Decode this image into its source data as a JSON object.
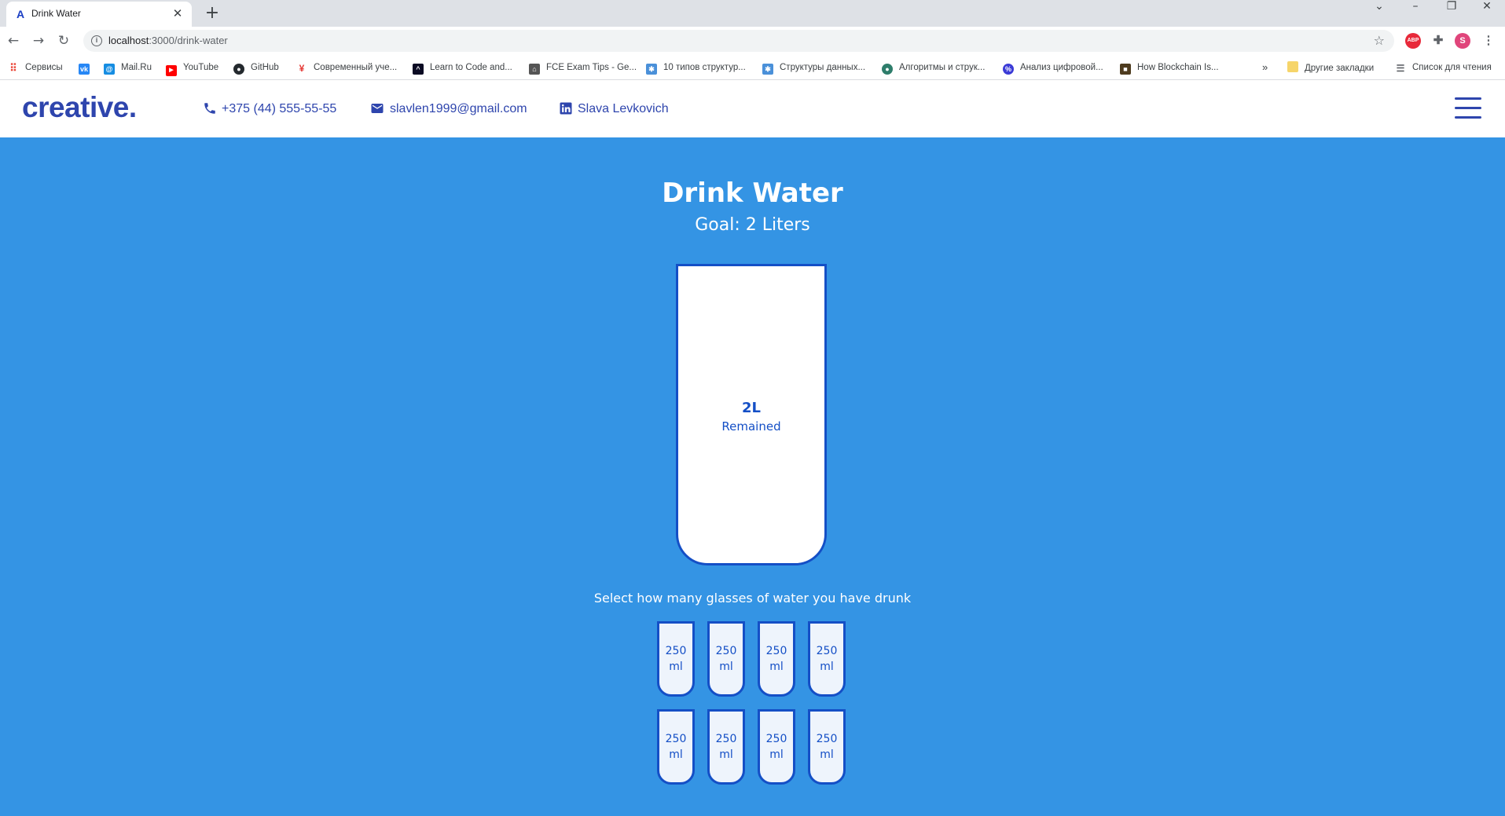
{
  "browser": {
    "tab_title": "Drink Water",
    "tab_favicon": "A",
    "url_host": "localhost",
    "url_rest": ":3000/drink-water",
    "profile_initial": "S",
    "ext_abp": "ABP"
  },
  "bookmarks": [
    {
      "label": "Сервисы",
      "icon": "apps-icon",
      "color": "#ea4335"
    },
    {
      "label": "",
      "icon": "vk-icon",
      "color": "#2787f5"
    },
    {
      "label": "Mail.Ru",
      "icon": "mailru-icon",
      "color": "#168de2"
    },
    {
      "label": "YouTube",
      "icon": "youtube-icon",
      "color": "#ff0000"
    },
    {
      "label": "GitHub",
      "icon": "github-icon",
      "color": "#24292e"
    },
    {
      "label": "Современный уче...",
      "icon": "runner-icon",
      "color": "#e53935"
    },
    {
      "label": "Learn to Code and...",
      "icon": "freecodecamp-icon",
      "color": "#0a0a23"
    },
    {
      "label": "FCE Exam Tips - Ge...",
      "icon": "hat-icon",
      "color": "#555555"
    },
    {
      "label": "10 типов структур...",
      "icon": "gear-icon",
      "color": "#4a90d9"
    },
    {
      "label": "Структуры данных...",
      "icon": "gear-icon",
      "color": "#4a90d9"
    },
    {
      "label": "Алгоритмы и струк...",
      "icon": "globe-icon",
      "color": "#2e7d6b"
    },
    {
      "label": "Анализ цифровой...",
      "icon": "percent-icon",
      "color": "#3b3bd6"
    },
    {
      "label": "How Blockchain Is...",
      "icon": "book-icon",
      "color": "#4e3b1f"
    }
  ],
  "bookmarks_more": "»",
  "bookmarks_other": "Другие закладки",
  "bookmarks_reading": "Список для чтения",
  "header": {
    "logo": "creative.",
    "phone": "+375 (44) 555-55-55",
    "email": "slavlen1999@gmail.com",
    "linkedin": "Slava Levkovich"
  },
  "main": {
    "title": "Drink Water",
    "goal": "Goal: 2 Liters",
    "remained_value": "2L",
    "remained_label": "Remained",
    "instruction": "Select how many glasses of water you have drunk",
    "cups": [
      {
        "amount": "250",
        "unit": "ml"
      },
      {
        "amount": "250",
        "unit": "ml"
      },
      {
        "amount": "250",
        "unit": "ml"
      },
      {
        "amount": "250",
        "unit": "ml"
      },
      {
        "amount": "250",
        "unit": "ml"
      },
      {
        "amount": "250",
        "unit": "ml"
      },
      {
        "amount": "250",
        "unit": "ml"
      },
      {
        "amount": "250",
        "unit": "ml"
      }
    ],
    "filled_cups": 0
  },
  "colors": {
    "page_bg": "#3494e4",
    "accent": "#2e45ad",
    "cup_border": "#144fc6"
  }
}
